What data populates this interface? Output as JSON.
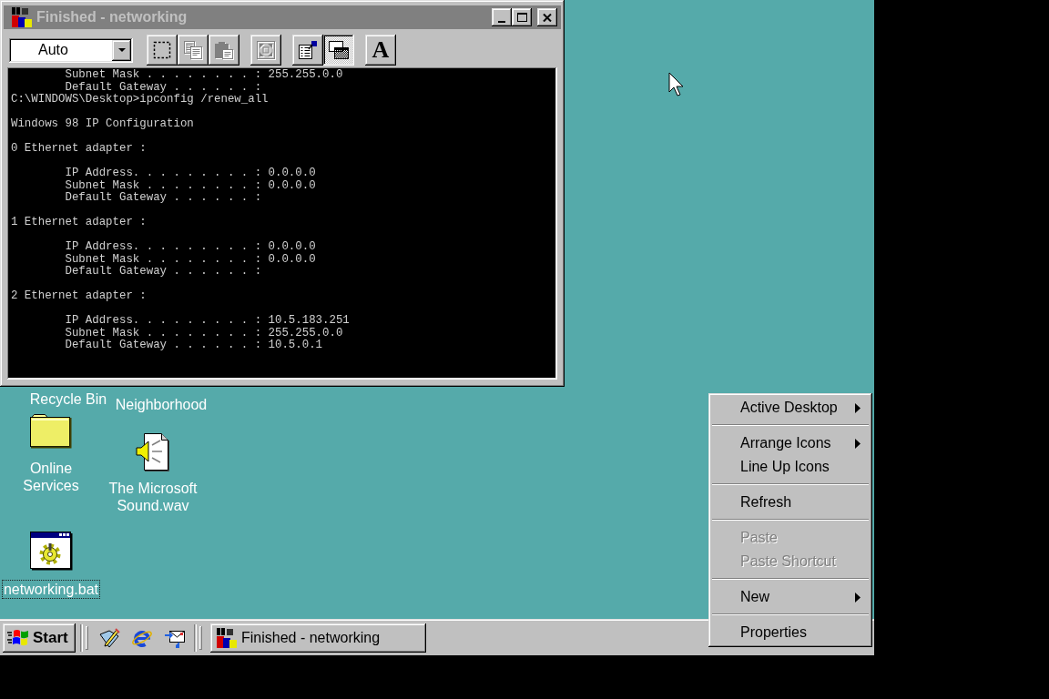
{
  "window": {
    "title": "Finished - networking",
    "active": false
  },
  "toolbar": {
    "font_size": "Auto",
    "groups": [
      {
        "buttons": [
          {
            "kind": "mark",
            "disabled": false,
            "pressed": false
          },
          {
            "kind": "copy",
            "disabled": true,
            "pressed": false
          },
          {
            "kind": "paste",
            "disabled": true,
            "pressed": false
          }
        ]
      },
      {
        "buttons": [
          {
            "kind": "full-screen",
            "disabled": true,
            "pressed": false
          }
        ]
      },
      {
        "buttons": [
          {
            "kind": "properties",
            "disabled": false,
            "pressed": false
          },
          {
            "kind": "background",
            "disabled": false,
            "pressed": true
          }
        ]
      },
      {
        "buttons": [
          {
            "kind": "font",
            "label": "A",
            "disabled": false,
            "pressed": false
          }
        ]
      }
    ]
  },
  "console": {
    "blocks": [
      {
        "lines": [
          {
            "kind": "field",
            "text": "Subnet Mask . . . . . . . . : 255.255.0.0"
          },
          {
            "kind": "field",
            "text": "Default Gateway . . . . . . :"
          },
          {
            "kind": "command",
            "text": "C:\\WINDOWS\\Desktop>ipconfig /renew_all"
          }
        ]
      },
      {
        "lines": [
          {
            "kind": "heading",
            "text": "Windows 98 IP Configuration"
          }
        ]
      },
      {
        "lines": [
          {
            "kind": "heading",
            "text": "0 Ethernet adapter :"
          }
        ]
      },
      {
        "lines": [
          {
            "kind": "field",
            "text": "IP Address. . . . . . . . . : 0.0.0.0"
          },
          {
            "kind": "field",
            "text": "Subnet Mask . . . . . . . . : 0.0.0.0"
          },
          {
            "kind": "field",
            "text": "Default Gateway . . . . . . :"
          }
        ]
      },
      {
        "lines": [
          {
            "kind": "heading",
            "text": "1 Ethernet adapter :"
          }
        ]
      },
      {
        "lines": [
          {
            "kind": "field",
            "text": "IP Address. . . . . . . . . : 0.0.0.0"
          },
          {
            "kind": "field",
            "text": "Subnet Mask . . . . . . . . : 0.0.0.0"
          },
          {
            "kind": "field",
            "text": "Default Gateway . . . . . . :"
          }
        ]
      },
      {
        "lines": [
          {
            "kind": "heading",
            "text": "2 Ethernet adapter :"
          }
        ]
      },
      {
        "lines": [
          {
            "kind": "field",
            "text": "IP Address. . . . . . . . . : 10.5.183.251"
          },
          {
            "kind": "field",
            "text": "Subnet Mask . . . . . . . . : 255.255.0.0"
          },
          {
            "kind": "field",
            "text": "Default Gateway . . . . . . : 10.5.0.1"
          }
        ]
      }
    ]
  },
  "desktop_icons": [
    {
      "kind": "covered",
      "label": "Recycle Bin",
      "focused": false
    },
    {
      "kind": "covered",
      "label": "Neighborhood",
      "focused": false
    },
    {
      "kind": "folder",
      "label": "Online Services",
      "focused": false
    },
    {
      "kind": "sound-file",
      "label": "The Microsoft Sound.wav",
      "focused": false
    },
    {
      "kind": "batch-file",
      "label": "networking.bat",
      "focused": true
    }
  ],
  "context_menu": {
    "sections": [
      {
        "items": [
          {
            "label": "Active Desktop",
            "submenu": true,
            "disabled": false
          }
        ]
      },
      {
        "items": [
          {
            "label": "Arrange Icons",
            "submenu": true,
            "disabled": false
          },
          {
            "label": "Line Up Icons",
            "submenu": false,
            "disabled": false
          }
        ]
      },
      {
        "items": [
          {
            "label": "Refresh",
            "submenu": false,
            "disabled": false
          }
        ]
      },
      {
        "items": [
          {
            "label": "Paste",
            "submenu": false,
            "disabled": true
          },
          {
            "label": "Paste Shortcut",
            "submenu": false,
            "disabled": true
          }
        ]
      },
      {
        "items": [
          {
            "label": "New",
            "submenu": true,
            "disabled": false
          }
        ]
      },
      {
        "items": [
          {
            "label": "Properties",
            "submenu": false,
            "disabled": false
          }
        ]
      }
    ]
  },
  "taskbar": {
    "start": "Start",
    "quick_launch": [
      {
        "kind": "desktop"
      },
      {
        "kind": "browser"
      },
      {
        "kind": "mail"
      }
    ],
    "tasks": [
      {
        "label": "Finished - networking",
        "selected": false
      }
    ]
  }
}
